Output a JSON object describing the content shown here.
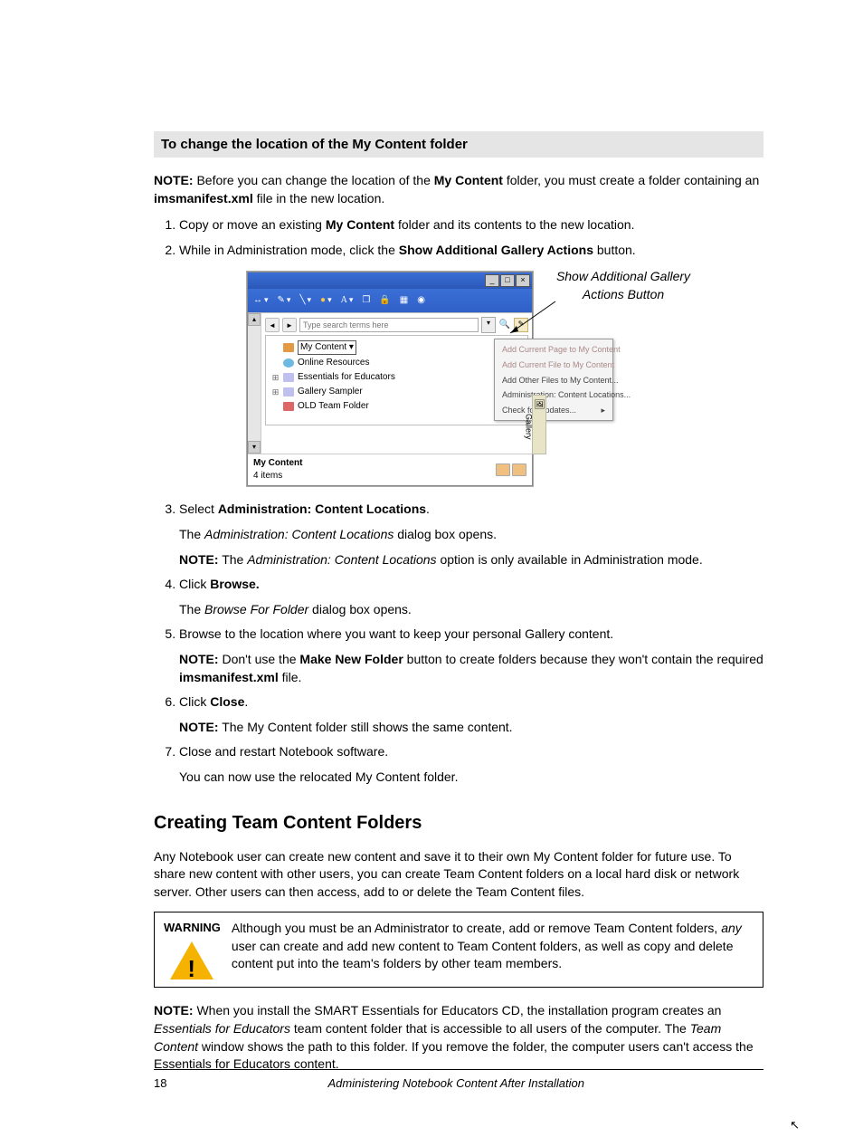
{
  "proc_heading": "To change the location of the My Content folder",
  "intro_note": {
    "lead": "NOTE:",
    "t1": " Before you can change the location of the ",
    "b1": "My Content",
    "t2": " folder, you must create a folder containing an ",
    "b2": "imsmanifest.xml",
    "t3": " file in the new location."
  },
  "step1": {
    "t1": "Copy or move an existing ",
    "b1": "My Content",
    "t2": " folder and its contents to the new location."
  },
  "step2": {
    "t1": "While in Administration mode, click the ",
    "b1": "Show Additional Gallery Actions",
    "t2": " button."
  },
  "callout": "Show Additional Gallery Actions Button",
  "screenshot": {
    "search_placeholder": "Type search terms here",
    "tree": {
      "mycontent": "My Content",
      "online": "Online Resources",
      "educators": "Essentials for Educators",
      "sampler": "Gallery Sampler",
      "oldteam": "OLD Team Folder"
    },
    "menu": {
      "i1": "Add Current Page to My Content",
      "i2": "Add Current File to My Content",
      "i3": "Add Other Files to My Content...",
      "i4": "Administration: Content Locations...",
      "i5": "Check for Updates..."
    },
    "sidetab": "Gallery",
    "bottom_title": "My Content",
    "bottom_count": "4 items"
  },
  "step3": {
    "t1": "Select ",
    "b1": "Administration: Content Locations",
    "t2": ".",
    "sub1_a": "The ",
    "sub1_i": "Administration: Content Locations",
    "sub1_b": " dialog box opens.",
    "sub2_lead": "NOTE:",
    "sub2_a": " The ",
    "sub2_i": "Administration: Content Locations",
    "sub2_b": " option is only available in Administration mode."
  },
  "step4": {
    "t1": "Click ",
    "b1": "Browse.",
    "sub_a": "The ",
    "sub_i": "Browse For Folder",
    "sub_b": " dialog box opens."
  },
  "step5": {
    "t1": "Browse to the location where you want to keep your personal Gallery content.",
    "sub_lead": "NOTE:",
    "sub_a": " Don't use the ",
    "sub_b1": "Make New Folder",
    "sub_c": " button to create folders because they won't contain the required ",
    "sub_b2": "imsmanifest.xml",
    "sub_d": " file."
  },
  "step6": {
    "t1": "Click ",
    "b1": "Close",
    "t2": ".",
    "sub_lead": "NOTE:",
    "sub_a": " The My Content folder still shows the same content."
  },
  "step7": {
    "t1": "Close and restart Notebook software.",
    "sub": "You can now use the relocated My Content folder."
  },
  "section_heading": "Creating Team Content Folders",
  "section_para": "Any Notebook user can create new content and save it to their own My Content folder for future use. To share new content with other users, you can create Team Content folders on a local hard disk or network server. Other users can then access, add to or delete the Team Content files.",
  "warning": {
    "label": "WARNING",
    "t1": "Although you must be an Administrator to create, add or remove Team Content folders, ",
    "i1": "any",
    "t2": " user can create and add new content to Team Content folders, as well as copy and delete content put into the team's folders by other team members."
  },
  "post_note": {
    "lead": "NOTE:",
    "t1": " When you install the SMART Essentials for Educators CD, the installation program creates an ",
    "i1": "Essentials for Educators",
    "t2": " team content folder that is accessible to all users of the computer. The ",
    "i2": "Team Content",
    "t3": " window shows the path to this folder. If you remove the folder, the computer users can't access the Essentials for Educators content."
  },
  "footer": {
    "page": "18",
    "title": "Administering Notebook Content After Installation"
  }
}
